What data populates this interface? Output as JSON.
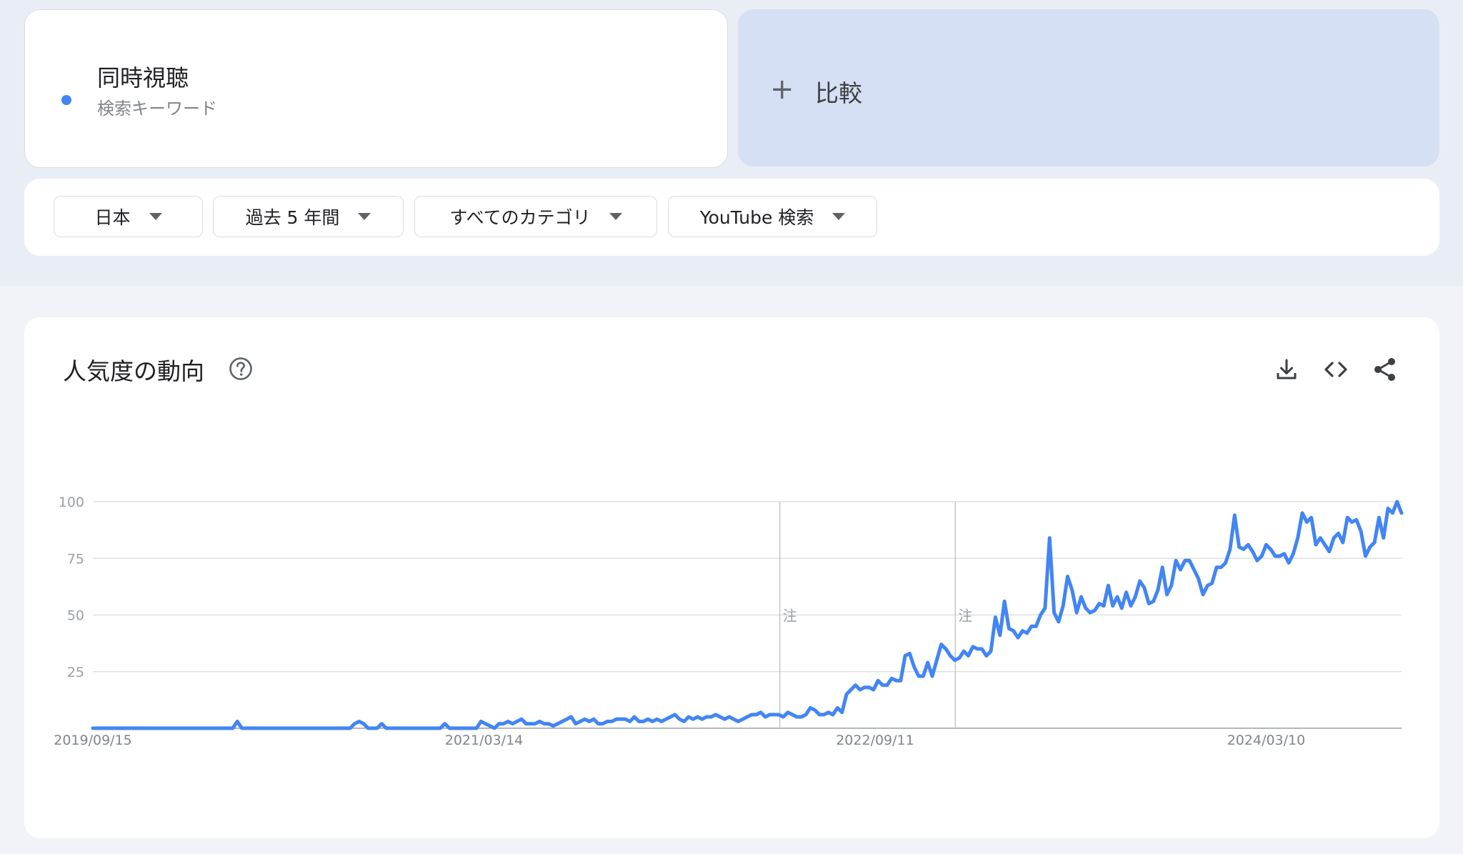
{
  "search_term": {
    "name": "同時視聴",
    "type": "検索キーワード",
    "color": "#4285f4"
  },
  "compare": {
    "label": "比較",
    "icon": "plus-icon"
  },
  "filters": [
    {
      "label": "日本"
    },
    {
      "label": "過去 5 年間"
    },
    {
      "label": "すべてのカテゴリ"
    },
    {
      "label": "YouTube 検索"
    }
  ],
  "widget": {
    "title": "人気度の動向",
    "help_icon": "help-circle-icon",
    "actions": [
      "download-icon",
      "embed-code-icon",
      "share-icon"
    ]
  },
  "chart_data": {
    "type": "line",
    "ylim": [
      0,
      100
    ],
    "yticks": [
      25,
      50,
      75,
      100
    ],
    "xtick_labels": [
      "2019/09/15",
      "2021/03/14",
      "2022/09/11",
      "2024/03/10"
    ],
    "grid": true,
    "series": [
      {
        "color": "#4285f4",
        "values": [
          0,
          0,
          0,
          0,
          0,
          0,
          0,
          0,
          0,
          0,
          0,
          0,
          0,
          0,
          0,
          0,
          0,
          0,
          0,
          0,
          0,
          0,
          0,
          0,
          0,
          0,
          0,
          0,
          0,
          0,
          0,
          0,
          3,
          0,
          0,
          0,
          0,
          0,
          0,
          0,
          0,
          0,
          0,
          0,
          0,
          0,
          0,
          0,
          0,
          0,
          0,
          0,
          0,
          0,
          0,
          0,
          0,
          0,
          2,
          3,
          2,
          0,
          0,
          0,
          2,
          0,
          0,
          0,
          0,
          0,
          0,
          0,
          0,
          0,
          0,
          0,
          0,
          0,
          2,
          0,
          0,
          0,
          0,
          0,
          0,
          0,
          3,
          2,
          1,
          0,
          2,
          2,
          3,
          2,
          3,
          4,
          2,
          2,
          2,
          3,
          2,
          2,
          1,
          2,
          3,
          4,
          5,
          2,
          3,
          4,
          3,
          4,
          2,
          2,
          3,
          3,
          4,
          4,
          4,
          3,
          5,
          3,
          3,
          4,
          3,
          4,
          3,
          4,
          5,
          6,
          4,
          3,
          5,
          4,
          5,
          4,
          5,
          5,
          6,
          5,
          4,
          5,
          4,
          3,
          4,
          5,
          6,
          6,
          7,
          5,
          6,
          6,
          6,
          5,
          7,
          6,
          5,
          5,
          6,
          9,
          8,
          6,
          6,
          7,
          6,
          9,
          7,
          15,
          17,
          19,
          17,
          18,
          18,
          17,
          21,
          19,
          19,
          22,
          21,
          21,
          32,
          33,
          27,
          23,
          23,
          29,
          23,
          30,
          37,
          35,
          32,
          30,
          31,
          34,
          32,
          36,
          35,
          35,
          32,
          34,
          49,
          41,
          56,
          44,
          43,
          40,
          43,
          42,
          45,
          45,
          50,
          53,
          84,
          51,
          47,
          54,
          67,
          61,
          51,
          58,
          53,
          51,
          52,
          55,
          54,
          63,
          54,
          58,
          53,
          60,
          54,
          58,
          65,
          62,
          55,
          56,
          61,
          71,
          59,
          63,
          74,
          70,
          74,
          74,
          70,
          66,
          59,
          63,
          64,
          71,
          71,
          73,
          79,
          94,
          80,
          79,
          81,
          78,
          74,
          76,
          81,
          79,
          76,
          76,
          77,
          73,
          77,
          84,
          95,
          91,
          93,
          81,
          84,
          81,
          78,
          84,
          86,
          82,
          93,
          91,
          92,
          87,
          76,
          80,
          82,
          93,
          84,
          97,
          95,
          100,
          95
        ]
      }
    ],
    "annotations": [
      {
        "x": "2022/05",
        "label": "注"
      },
      {
        "x": "2023/01",
        "label": "注"
      }
    ]
  }
}
